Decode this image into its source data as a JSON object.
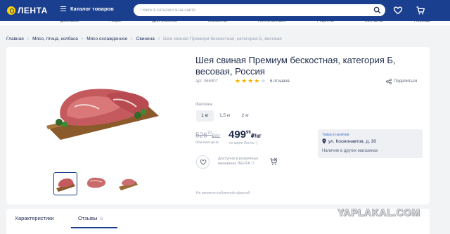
{
  "header": {
    "logo_text": "ЛЕНТА",
    "catalog_label": "Каталог товаров",
    "search_placeholder": "Поиск в каталоге и на сайте"
  },
  "subnav": {
    "items": [
      "Доставка",
      "Акции",
      "Для бизнеса",
      "Магазины",
      "Лента Онлайн",
      "Рецепты",
      "Контакты",
      "Помощь"
    ]
  },
  "breadcrumb": [
    "Главная",
    "Мясо, птица, колбаса",
    "Мясо охлажденное",
    "Свинина",
    "Шея свиная Премиум бескостная, категория Б, весовая"
  ],
  "product": {
    "title": "Шея свиная Премиум бескостная, категория Б, весовая, Россия",
    "sku": "арт. 066907",
    "rating": 4,
    "rating_max": 5,
    "reviews_label": "6 отзывов",
    "share_label": "Поделиться",
    "weight_label": "Фасовка",
    "weights": [
      "1 кг",
      "1.5 кг",
      "2 кг"
    ],
    "selected_weight": "1 кг",
    "old_price": {
      "main": "526",
      "cents": "70",
      "unit": "₽/кг"
    },
    "new_price": {
      "main": "499",
      "cents": "99",
      "unit": "₽/кг"
    },
    "old_price_caption": "обычная цена",
    "new_price_caption": "по карте Лента",
    "available_text": "Доступно в розничных магазинах ЛЕНТА",
    "offer_note": "Не является публичной офертой"
  },
  "store": {
    "status": "Товар в наличии",
    "address": "ул. Космонавтов, д. 30",
    "other_stores": "Наличие в других магазинах"
  },
  "tabs": [
    {
      "label": "Характеристики",
      "count": ""
    },
    {
      "label": "Отзывы",
      "count": "6"
    }
  ],
  "watermark": "YAPLAKAL.COM",
  "colors": {
    "header_bg": "#1a3f8f",
    "logo_yellow": "#ffd200",
    "star_filled": "#f5b400",
    "star_empty": "#d9dde5"
  }
}
